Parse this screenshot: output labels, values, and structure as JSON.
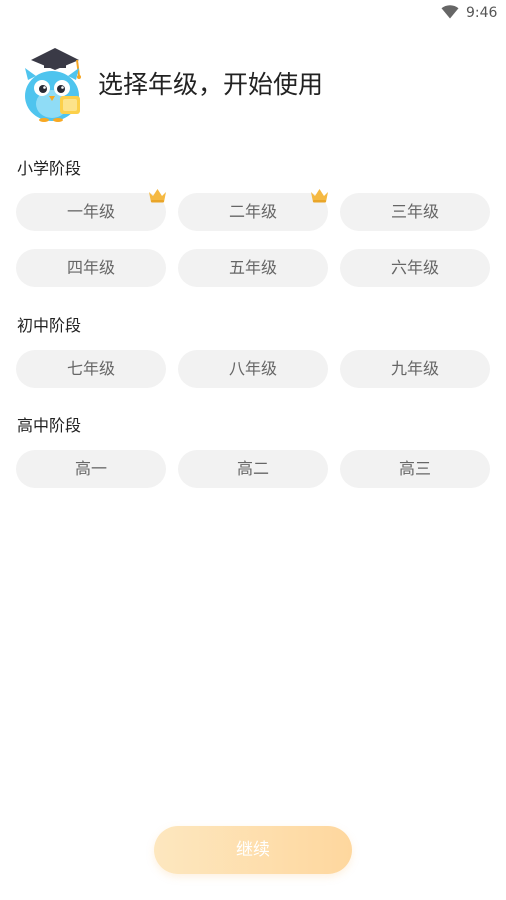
{
  "status_bar": {
    "time": "9:46",
    "icons": [
      "wifi-icon"
    ]
  },
  "header": {
    "title": "选择年级，开始使用",
    "mascot_icon": "owl-mascot-icon"
  },
  "sections": [
    {
      "title": "小学阶段",
      "grades": [
        {
          "label": "一年级",
          "premium": true
        },
        {
          "label": "二年级",
          "premium": true
        },
        {
          "label": "三年级",
          "premium": false
        },
        {
          "label": "四年级",
          "premium": false
        },
        {
          "label": "五年级",
          "premium": false
        },
        {
          "label": "六年级",
          "premium": false
        }
      ]
    },
    {
      "title": "初中阶段",
      "grades": [
        {
          "label": "七年级",
          "premium": false
        },
        {
          "label": "八年级",
          "premium": false
        },
        {
          "label": "九年级",
          "premium": false
        }
      ]
    },
    {
      "title": "高中阶段",
      "grades": [
        {
          "label": "高一",
          "premium": false
        },
        {
          "label": "高二",
          "premium": false
        },
        {
          "label": "高三",
          "premium": false
        }
      ]
    }
  ],
  "continue_button": {
    "label": "继续"
  },
  "colors": {
    "pill_background": "#f2f2f2",
    "pill_text": "#666666",
    "crown": "#f5b942",
    "continue_gradient_start": "#fde7bf",
    "continue_gradient_end": "#fed79e"
  }
}
